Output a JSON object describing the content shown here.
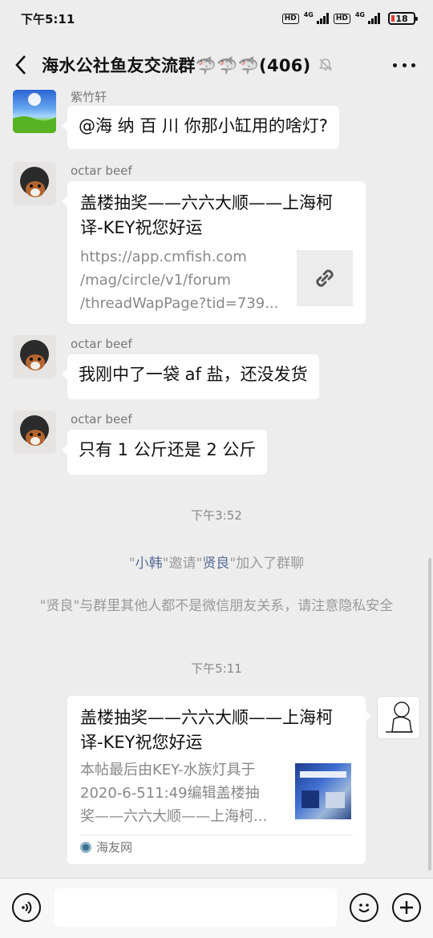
{
  "status_bar": {
    "time": "下午5:11",
    "hd1": "HD",
    "net1": "4G",
    "hd2": "HD",
    "net2": "4G",
    "battery": "18"
  },
  "header": {
    "title": "海水公社鱼友交流群🦈🦈🦈(406)",
    "icons": [
      "back-arrow-icon",
      "mute-bell-icon",
      "more-dots-icon"
    ]
  },
  "messages": [
    {
      "sender": "紫竹轩",
      "text": "@海 纳 百 川  你那小缸用的啥灯?"
    },
    {
      "sender": "octar beef",
      "card_title": "盖楼抽奖——六六大顺——上海柯译-KEY祝您好运",
      "card_lines": [
        "https://app.cmfish.com",
        "/mag/circle/v1/forum",
        "/threadWapPage?tid=739..."
      ]
    },
    {
      "sender": "octar beef",
      "text": "我刚中了一袋 af 盐，还没发货"
    },
    {
      "sender": "octar beef",
      "text": "只有 1 公斤还是 2 公斤"
    }
  ],
  "time_1": "下午3:52",
  "system": {
    "invite": {
      "q1": "\"",
      "inviter": "小韩",
      "q2": "\"邀请\"",
      "invitee": "贤良",
      "q3": "\"加入了群聊"
    },
    "privacy": "\"贤良\"与群里其他人都不是微信朋友关系，请注意隐私安全"
  },
  "time_2": "下午5:11",
  "my_card": {
    "title": "盖楼抽奖——六六大顺——上海柯译-KEY祝您好运",
    "lines": [
      "本帖最后由KEY-水族灯具于",
      "2020-6-511:49编辑盖楼抽",
      "奖——六六大顺——上海柯..."
    ],
    "source": "海友网"
  }
}
